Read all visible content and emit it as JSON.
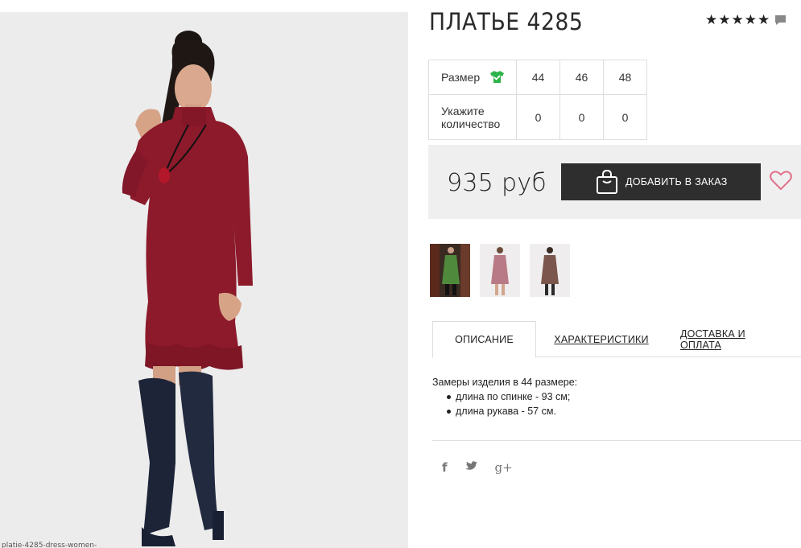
{
  "product": {
    "title": "ПЛАТЬЕ 4285",
    "rating_stars": 5,
    "photo_caption": "platie-4285-dress-women-"
  },
  "icons": {
    "star": "star-icon",
    "comment": "comment-icon",
    "size_guide": "tshirt-check-icon",
    "cart": "shopping-bag-icon",
    "wishlist": "heart-icon",
    "facebook": "facebook-icon",
    "twitter": "twitter-icon",
    "google_plus": "google-plus-icon"
  },
  "sizes": {
    "size_label": "Размер",
    "qty_label_line1": "Укажите",
    "qty_label_line2": "количество",
    "columns": [
      {
        "size": "44",
        "qty": "0"
      },
      {
        "size": "46",
        "qty": "0"
      },
      {
        "size": "48",
        "qty": "0"
      }
    ]
  },
  "purchase": {
    "price": "935 руб",
    "add_button": "ДОБАВИТЬ В ЗАКАЗ"
  },
  "variants": [
    {
      "color": "green"
    },
    {
      "color": "pink"
    },
    {
      "color": "brown"
    }
  ],
  "tabs": [
    {
      "label": "ОПИСАНИЕ",
      "active": true
    },
    {
      "label": "ХАРАКТЕРИСТИКИ",
      "active": false
    },
    {
      "label": "ДОСТАВКА И ОПЛАТА",
      "active": false
    }
  ],
  "description": {
    "intro": "Замеры изделия в 44 размере:",
    "items": [
      "длина по спинке - 93 см;",
      "длина рукава - 57 см."
    ]
  },
  "social": {
    "facebook": "f",
    "google_plus": "g+"
  },
  "colors": {
    "dress": "#8c1a2b",
    "boots": "#1d2438",
    "button_bg": "#2e2e2e",
    "price_box_bg": "#efefef",
    "heart": "#e0708a",
    "size_icon": "#2db34a"
  }
}
